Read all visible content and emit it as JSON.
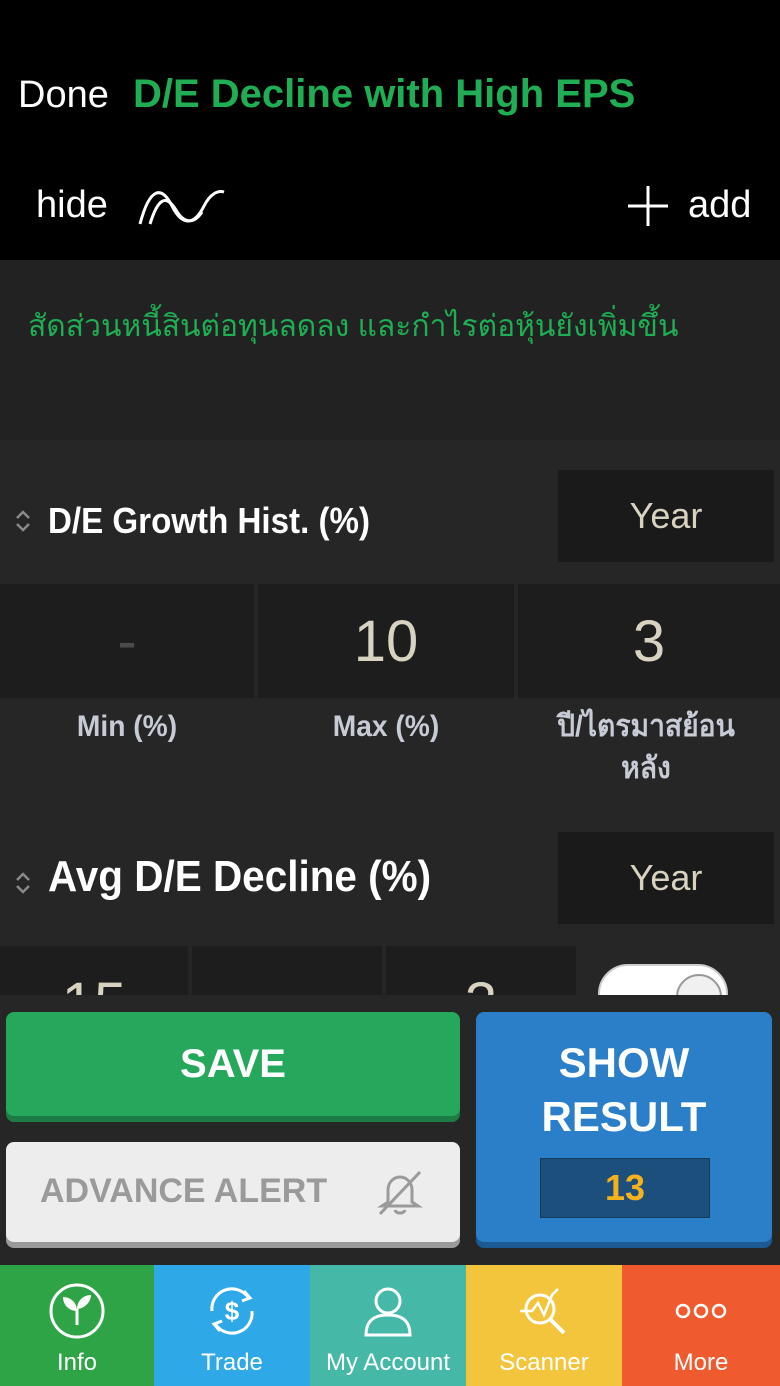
{
  "header": {
    "done_label": "Done",
    "title": "D/E Decline with High EPS",
    "hide_label": "hide",
    "add_label": "add"
  },
  "description": "สัดส่วนหนี้สินต่อทุนลดลง และกำไรต่อหุ้นยังเพิ่มขึ้น",
  "filters": [
    {
      "label": "D/E Growth Hist. (%)",
      "period": "Year",
      "min_value": "-",
      "max_value": "10",
      "years_value": "3",
      "min_label": "Min (%)",
      "max_label": "Max (%)",
      "years_label": "ปี/ไตรมาสย้อนหลัง"
    },
    {
      "label": "Avg D/E Decline (%)",
      "period": "Year",
      "value1": "15",
      "value3": "3"
    }
  ],
  "actions": {
    "save_label": "SAVE",
    "alert_label": "ADVANCE ALERT",
    "show_result_label": "SHOW RESULT",
    "result_count": "13"
  },
  "tabs": [
    {
      "label": "Info",
      "color": "#2ea447"
    },
    {
      "label": "Trade",
      "color": "#2fa8e8"
    },
    {
      "label": "My Account",
      "color": "#45b8a8"
    },
    {
      "label": "Scanner",
      "color": "#f2c53d"
    },
    {
      "label": "More",
      "color": "#ef5a2e"
    }
  ],
  "colors": {
    "accent_green": "#1fae54",
    "show_blue": "#2a7fc8",
    "count_orange": "#f5b21a"
  }
}
